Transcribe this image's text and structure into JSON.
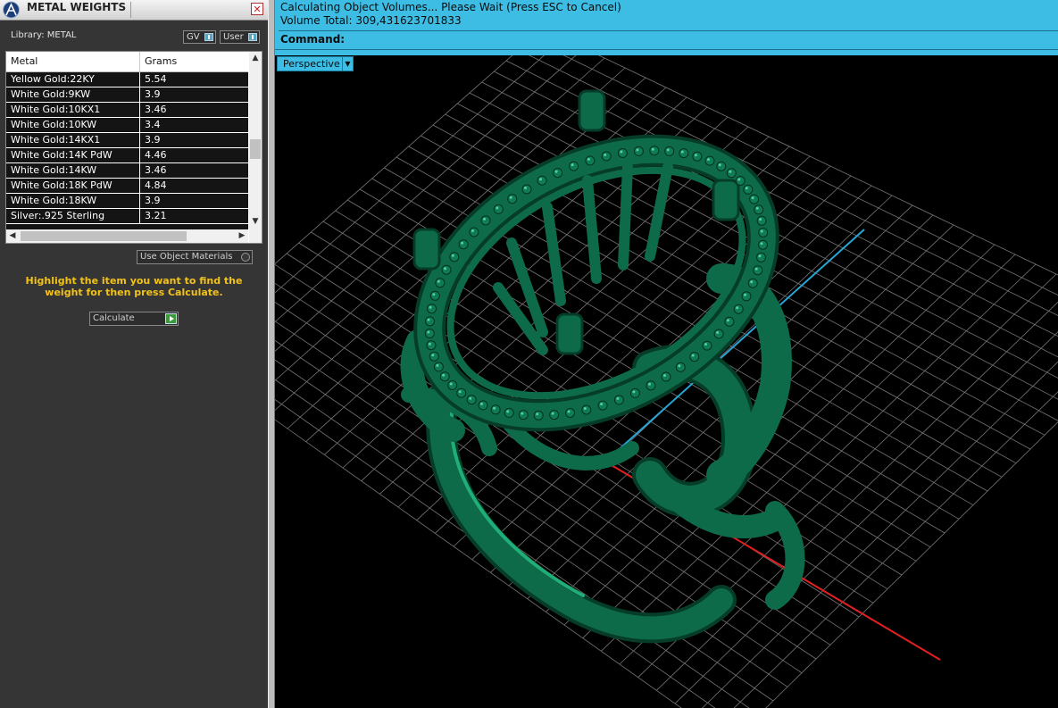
{
  "panel": {
    "title": "METAL WEIGHTS",
    "close_symbol": "✕",
    "library_label": "Library: METAL",
    "toggles": {
      "gv_label": "GV",
      "user_label": "User"
    },
    "table": {
      "headers": {
        "metal": "Metal",
        "grams": "Grams"
      },
      "rows": [
        {
          "metal": "Yellow Gold:22KY",
          "grams": "5.54"
        },
        {
          "metal": "White Gold:9KW",
          "grams": "3.9"
        },
        {
          "metal": "White Gold:10KX1",
          "grams": "3.46"
        },
        {
          "metal": "White Gold:10KW",
          "grams": "3.4"
        },
        {
          "metal": "White Gold:14KX1",
          "grams": "3.9"
        },
        {
          "metal": "White Gold:14K PdW",
          "grams": "4.46"
        },
        {
          "metal": "White Gold:14KW",
          "grams": "3.46"
        },
        {
          "metal": "White Gold:18K PdW",
          "grams": "4.84"
        },
        {
          "metal": "White Gold:18KW",
          "grams": "3.9"
        },
        {
          "metal": "Silver:.925 Sterling",
          "grams": "3.21"
        }
      ]
    },
    "use_object_materials_label": "Use Object Materials",
    "hint": "Highlight the item you want to find the weight for then press Calculate.",
    "calculate_label": "Calculate"
  },
  "command": {
    "status_line_1": "Calculating Object Volumes... Please Wait (Press ESC to Cancel)",
    "status_line_2": "Volume Total: 309,431623701833",
    "command_label": "Command:"
  },
  "viewport": {
    "view_name": "Perspective",
    "model_color": "#0e6b4a",
    "background": "#000000"
  },
  "colors": {
    "accent": "#3ebde4",
    "hint": "#f3c21a"
  }
}
